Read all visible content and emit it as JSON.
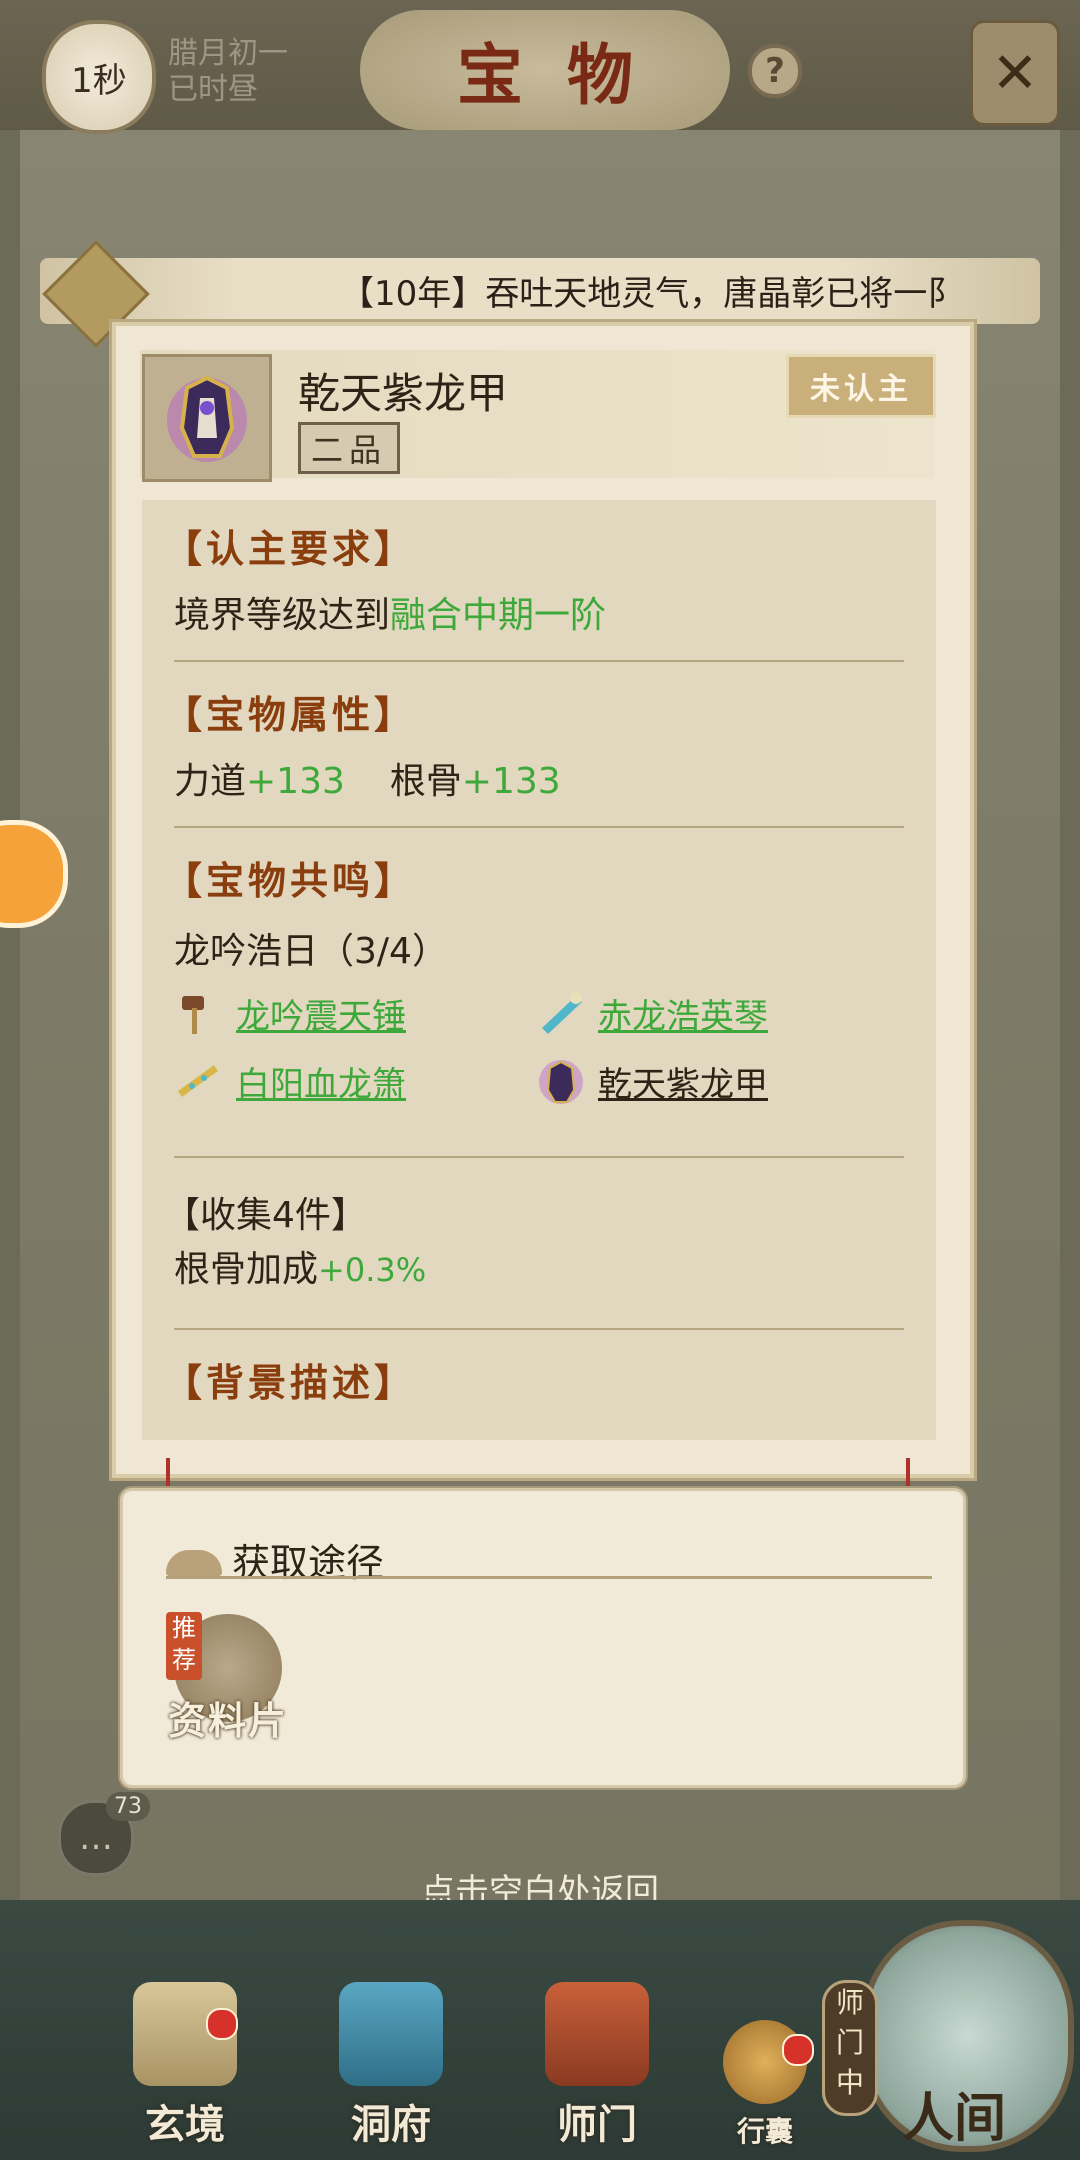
{
  "header": {
    "timer": "1秒",
    "date_line1": "腊月初一",
    "date_line2": "已时昼",
    "title": "宝物",
    "help": "?",
    "close": "✕"
  },
  "announcement": {
    "text": "【10年】吞吐天地灵气，唐晶彰已将一阝"
  },
  "item": {
    "name": "乾天紫龙甲",
    "grade": "二品",
    "status": "未认主"
  },
  "requirement": {
    "title": "【认主要求】",
    "prefix": "境界等级达到",
    "value": "融合中期一阶"
  },
  "attributes": {
    "title": "【宝物属性】",
    "items": [
      {
        "name": "力道",
        "value": "+133"
      },
      {
        "name": "根骨",
        "value": "+133"
      }
    ]
  },
  "resonance": {
    "title": "【宝物共鸣】",
    "set_name": "龙吟浩日（3/4）",
    "pieces": [
      {
        "name": "龙吟震天锤",
        "owned": true,
        "icon": "hammer-icon"
      },
      {
        "name": "赤龙浩英琴",
        "owned": true,
        "icon": "zither-icon"
      },
      {
        "name": "白阳血龙箫",
        "owned": true,
        "icon": "flute-icon"
      },
      {
        "name": "乾天紫龙甲",
        "owned": false,
        "icon": "armor-icon"
      }
    ],
    "bonus_title": "【收集4件】",
    "bonus_prefix": "根骨加成",
    "bonus_value": "+0.3%"
  },
  "background": {
    "title": "【背景描述】"
  },
  "obtain": {
    "title": "获取途径",
    "badge": "推荐",
    "source": "资料片"
  },
  "chat": {
    "count": "73"
  },
  "back_hint": "点击空白处返回",
  "nav": {
    "items": [
      "玄境",
      "洞府",
      "师门",
      "行囊"
    ],
    "sect_badge": "师门中",
    "world": "人间"
  },
  "colors": {
    "accent_green": "#3ea83a",
    "section_title": "#8a3e0e",
    "panel_bg": "#efe7d4"
  }
}
